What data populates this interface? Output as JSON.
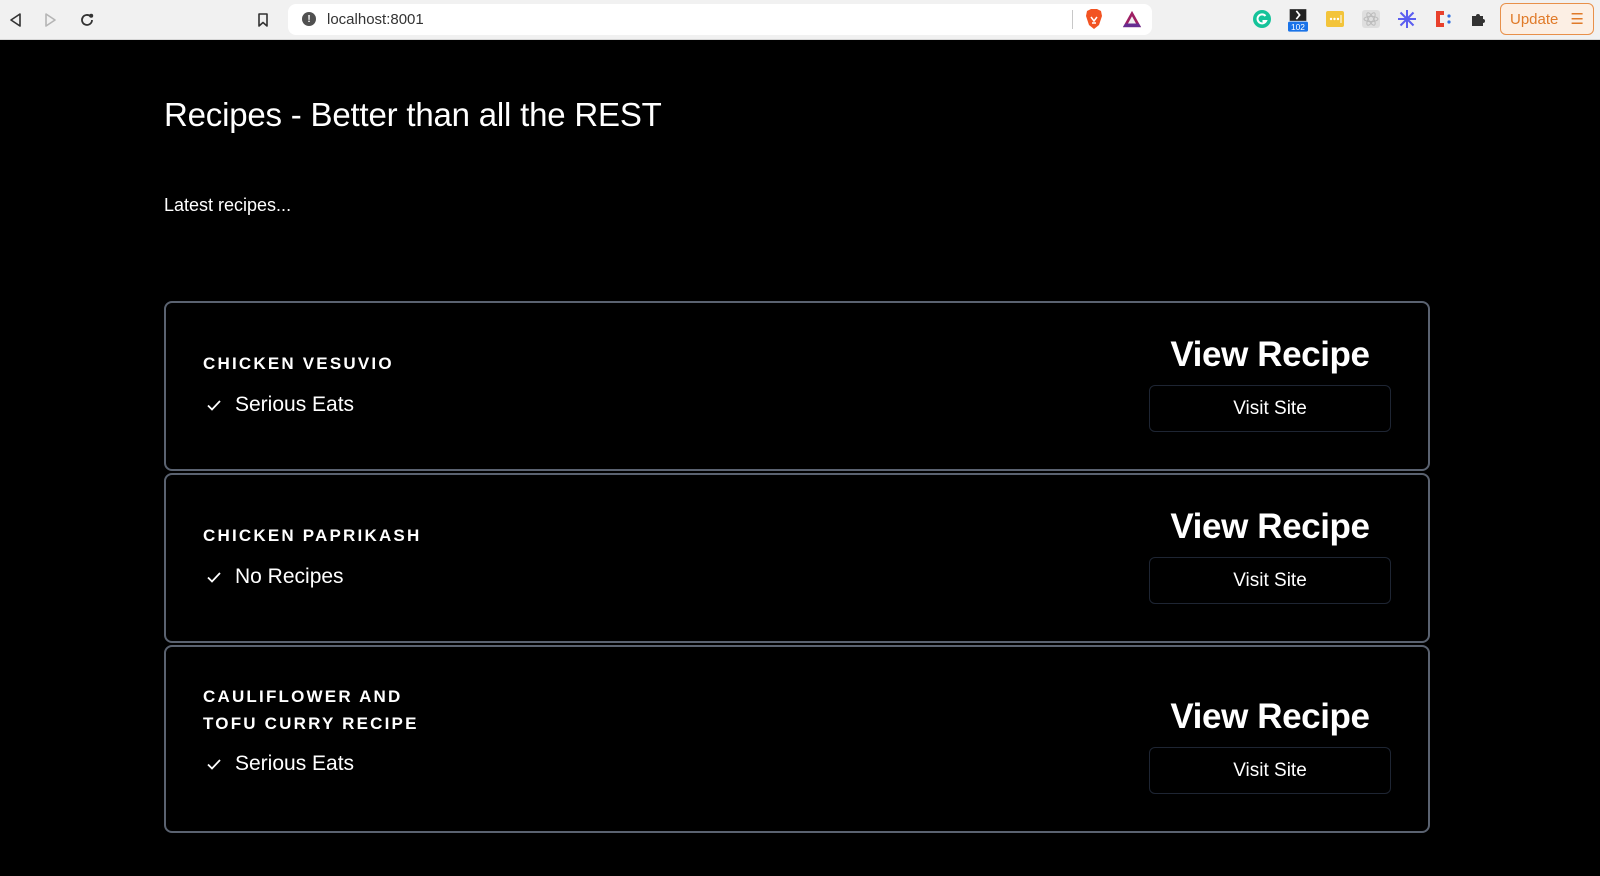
{
  "browser": {
    "url": "localhost:8001",
    "update_label": "Update",
    "extensions": [
      {
        "name": "grammarly-icon",
        "badge": ""
      },
      {
        "name": "extension-badge-icon",
        "badge": "102"
      },
      {
        "name": "password-manager-icon",
        "badge": ""
      },
      {
        "name": "react-devtools-icon",
        "badge": ""
      },
      {
        "name": "snowflake-extension-icon",
        "badge": ""
      },
      {
        "name": "c-extension-icon",
        "badge": ""
      },
      {
        "name": "extensions-puzzle-icon",
        "badge": ""
      }
    ],
    "colors": {
      "update_accent": "#e07a28",
      "brave_orange": "#f25322",
      "grammarly_green": "#15c39a",
      "badge_blue": "#1a73e8"
    }
  },
  "page": {
    "title": "Recipes - Better than all the REST",
    "subtitle": "Latest recipes..."
  },
  "recipes": [
    {
      "title": "Chicken Vesuvio",
      "source": "Serious Eats",
      "view_label": "View Recipe",
      "visit_label": "Visit Site"
    },
    {
      "title": "Chicken Paprikash",
      "source": "No Recipes",
      "view_label": "View Recipe",
      "visit_label": "Visit Site"
    },
    {
      "title": "Cauliflower and Tofu Curry Recipe",
      "source": "Serious Eats",
      "view_label": "View Recipe",
      "visit_label": "Visit Site"
    }
  ],
  "theme": {
    "background": "#000000",
    "card_border": "#5a6270",
    "text": "#ffffff"
  }
}
